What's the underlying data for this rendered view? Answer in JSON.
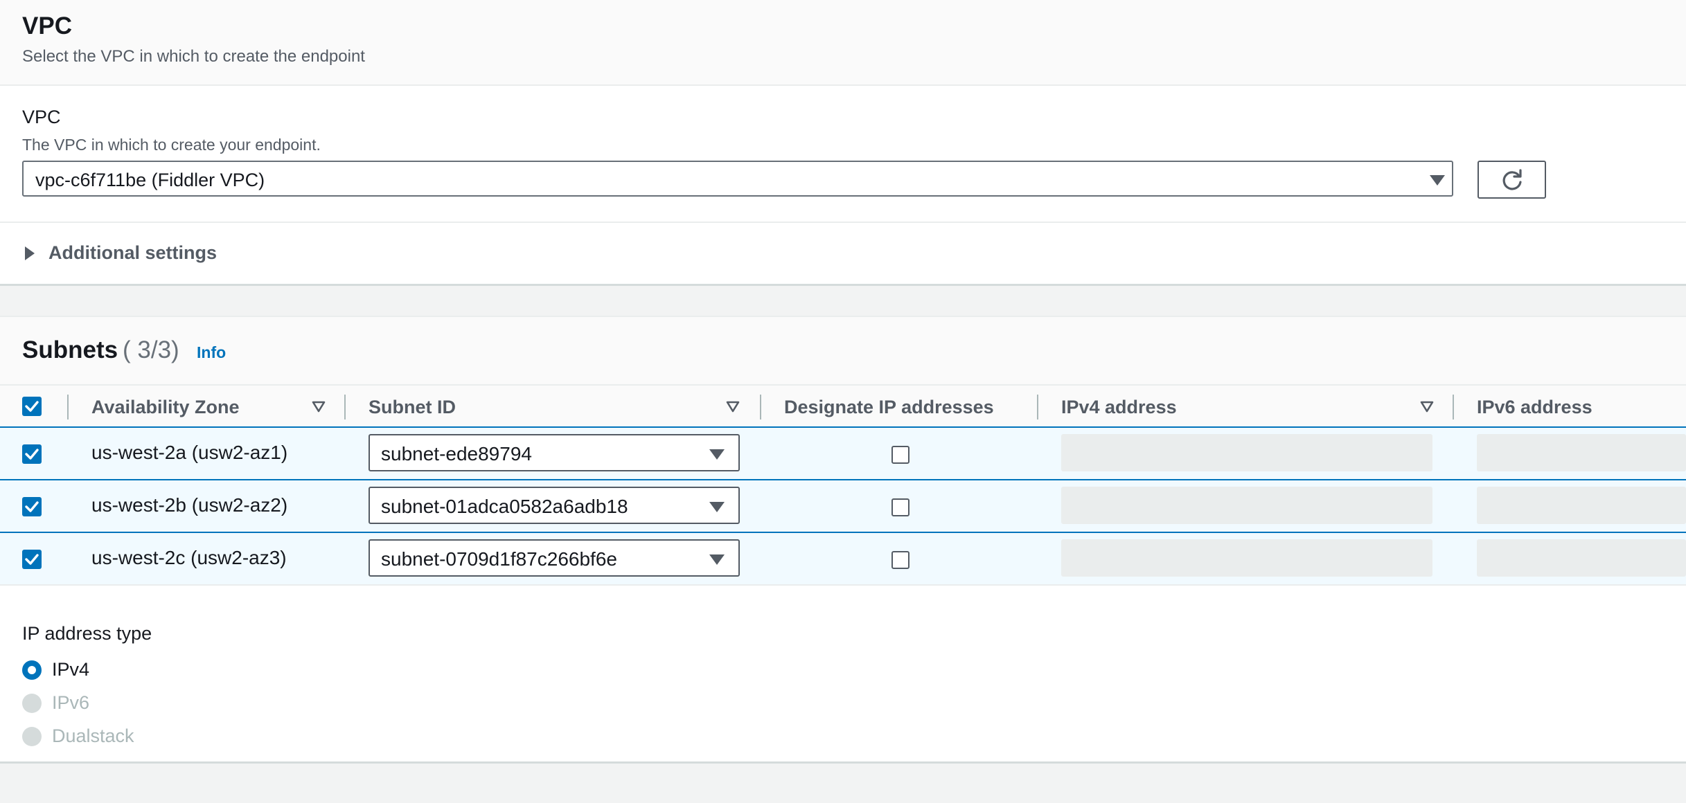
{
  "vpc_section": {
    "title": "VPC",
    "description": "Select the VPC in which to create the endpoint",
    "field_label": "VPC",
    "field_description": "The VPC in which to create your endpoint.",
    "selected_vpc": "vpc-c6f711be (Fiddler VPC)",
    "refresh_icon": "refresh-icon",
    "additional_settings_label": "Additional settings"
  },
  "subnets": {
    "title": "Subnets",
    "count": "( 3/3)",
    "info_label": "Info",
    "columns": [
      "Availability Zone",
      "Subnet ID",
      "Designate IP addresses",
      "IPv4 address",
      "IPv6 address"
    ],
    "rows": [
      {
        "checked": true,
        "availability_zone": "us-west-2a (usw2-az1)",
        "subnet_id": "subnet-ede89794",
        "designate_ip": false
      },
      {
        "checked": true,
        "availability_zone": "us-west-2b (usw2-az2)",
        "subnet_id": "subnet-01adca0582a6adb18",
        "designate_ip": false
      },
      {
        "checked": true,
        "availability_zone": "us-west-2c (usw2-az3)",
        "subnet_id": "subnet-0709d1f87c266bf6e",
        "designate_ip": false
      }
    ]
  },
  "ip_address_type": {
    "label": "IP address type",
    "options": [
      {
        "label": "IPv4",
        "selected": true,
        "disabled": false
      },
      {
        "label": "IPv6",
        "selected": false,
        "disabled": true
      },
      {
        "label": "Dualstack",
        "selected": false,
        "disabled": true
      }
    ]
  },
  "colors": {
    "accent": "#0073bb",
    "selected_row": "#f1faff",
    "text": "#16191f",
    "muted": "#545b64"
  }
}
